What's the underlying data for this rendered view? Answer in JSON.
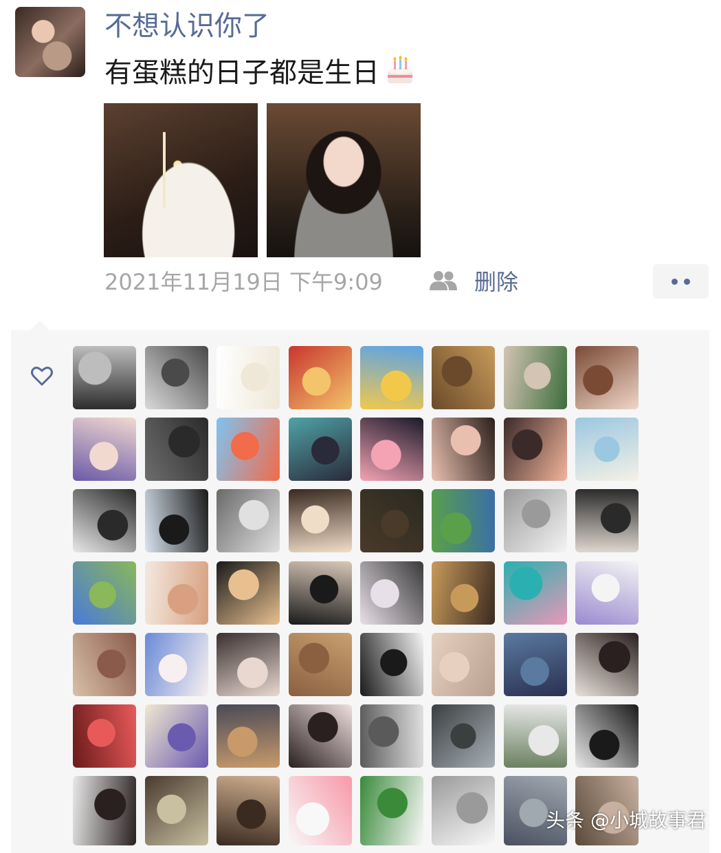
{
  "post": {
    "username": "不想认识你了",
    "text": "有蛋糕的日子都是生日",
    "emoji_icon": "birthday-cake-icon",
    "timestamp": "2021年11月19日 下午9:09",
    "visibility_icon": "friends-icon",
    "delete_label": "删除",
    "more_icon": "more-dots-icon"
  },
  "likes": {
    "icon": "heart-outline-icon",
    "count": 56
  },
  "watermark": "头条 @小城故事君",
  "colors": {
    "link_blue": "#576b95",
    "meta_gray": "#a6a6a6",
    "panel_bg": "#f6f6f6"
  }
}
